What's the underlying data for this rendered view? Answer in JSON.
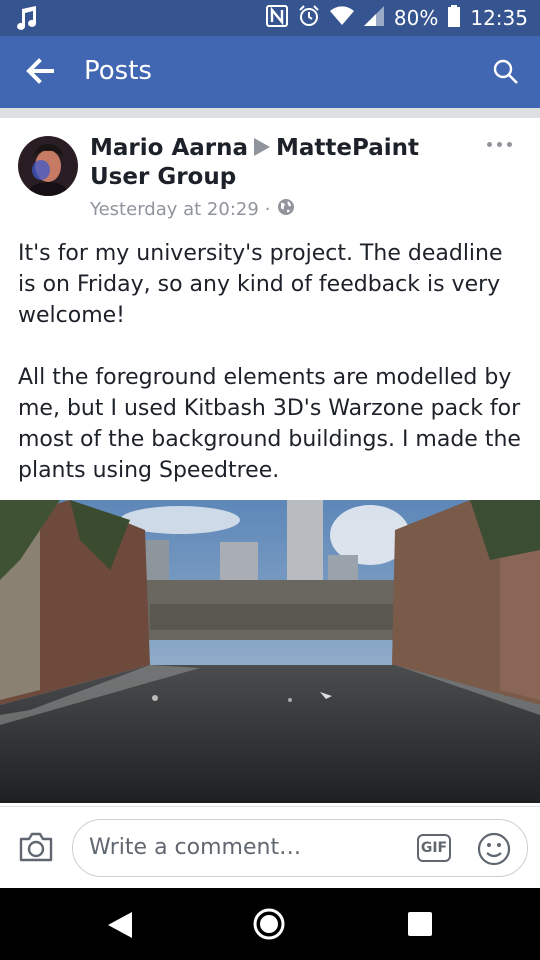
{
  "status_bar": {
    "battery": "80%",
    "time": "12:35",
    "icons": [
      "music-note-icon",
      "nfc-icon",
      "alarm-icon",
      "wifi-icon",
      "signal-icon",
      "battery-icon"
    ]
  },
  "app_bar": {
    "title": "Posts",
    "back_icon": "back-arrow-icon",
    "search_icon": "search-icon"
  },
  "post": {
    "author": "Mario Aarna",
    "group": "MattePaint User Group",
    "timestamp": "Yesterday at 20:29",
    "separator": "·",
    "privacy_icon": "globe-icon",
    "more_icon": "more-icon",
    "paragraphs": [
      "It's for my university's project. The deadline is on Friday, so any kind of feedback is very welcome!",
      "All the foreground elements are modelled by me, but I used Kitbash 3D's Warzone pack for most of the background buildings. I made the plants using Speedtree."
    ]
  },
  "comment_bar": {
    "placeholder": "Write a comment…",
    "gif_label": "GIF",
    "camera_icon": "camera-icon",
    "emoji_icon": "emoji-icon"
  },
  "nav_bar": {
    "icons": [
      "nav-back-icon",
      "nav-home-icon",
      "nav-recents-icon"
    ]
  },
  "colors": {
    "app_bar": "#4267b2",
    "status_bar": "#36548f",
    "meta_text": "#90949c"
  }
}
